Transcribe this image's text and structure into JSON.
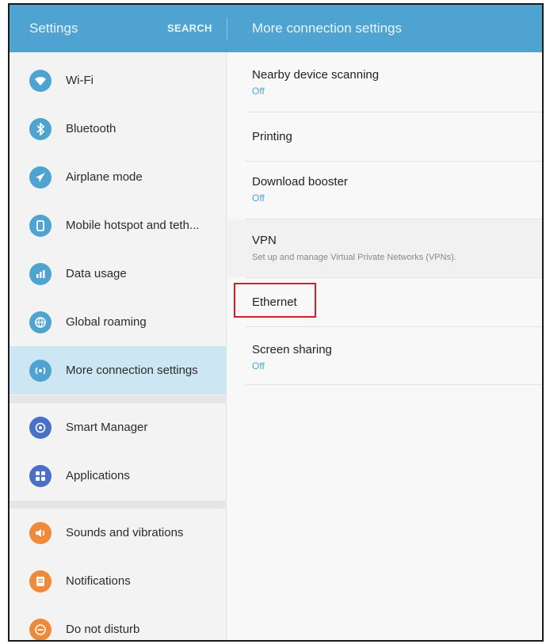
{
  "header": {
    "left_title": "Settings",
    "search_label": "SEARCH",
    "right_title": "More connection settings"
  },
  "sidebar": {
    "items": [
      {
        "label": "Wi-Fi",
        "icon": "wifi-icon",
        "color": "#4fa3d1",
        "glyph": "◔"
      },
      {
        "label": "Bluetooth",
        "icon": "bluetooth-icon",
        "color": "#4fa3d1",
        "glyph": "B"
      },
      {
        "label": "Airplane mode",
        "icon": "airplane-icon",
        "color": "#4fa3d1",
        "glyph": "✈"
      },
      {
        "label": "Mobile hotspot and teth...",
        "icon": "hotspot-icon",
        "color": "#4fa3d1",
        "glyph": "□"
      },
      {
        "label": "Data usage",
        "icon": "data-usage-icon",
        "color": "#4fa3d1",
        "glyph": "▁"
      },
      {
        "label": "Global roaming",
        "icon": "globe-icon",
        "color": "#4fa3d1",
        "glyph": "◎"
      },
      {
        "label": "More connection settings",
        "icon": "connection-settings-icon",
        "color": "#4fa3d1",
        "glyph": "⦿",
        "selected": true
      },
      {
        "label": "Smart Manager",
        "icon": "smart-manager-icon",
        "color": "#4a6fc9",
        "glyph": "◎"
      },
      {
        "label": "Applications",
        "icon": "applications-icon",
        "color": "#4a6fc9",
        "glyph": "☷"
      },
      {
        "label": "Sounds and vibrations",
        "icon": "sound-icon",
        "color": "#ee8a3c",
        "glyph": "◀"
      },
      {
        "label": "Notifications",
        "icon": "notifications-icon",
        "color": "#ee8a3c",
        "glyph": "▤"
      },
      {
        "label": "Do not disturb",
        "icon": "do-not-disturb-icon",
        "color": "#ee8a3c",
        "glyph": "⊖"
      }
    ]
  },
  "content": {
    "rows": [
      {
        "title": "Nearby device scanning",
        "sub": "Off"
      },
      {
        "title": "Printing",
        "sub": ""
      },
      {
        "title": "Download booster",
        "sub": "Off"
      },
      {
        "title": "VPN",
        "sub": "Set up and manage Virtual Private Networks (VPNs)."
      },
      {
        "title": "Ethernet",
        "sub": ""
      },
      {
        "title": "Screen sharing",
        "sub": "Off"
      }
    ]
  },
  "colors": {
    "accent": "#4fa3d1",
    "selected_bg": "#cde6f3",
    "highlight_box": "#d21f26"
  }
}
